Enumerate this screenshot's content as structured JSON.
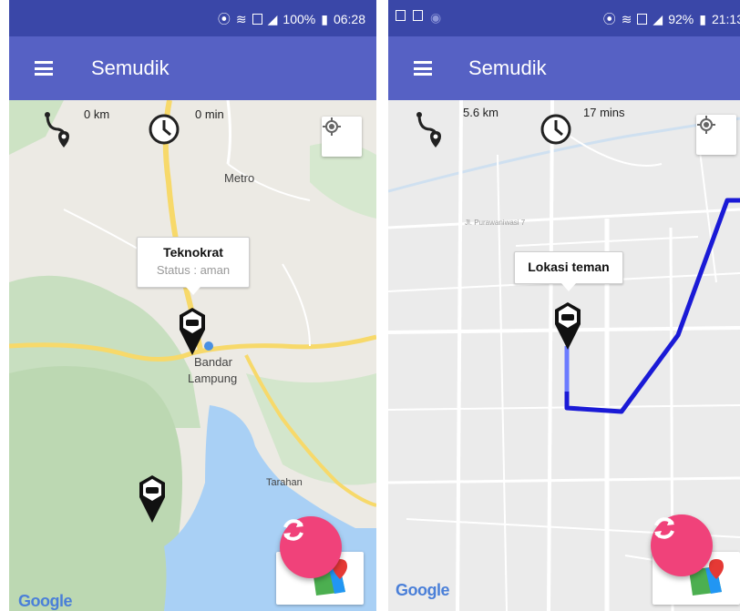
{
  "colors": {
    "appbar": "#5661c4",
    "statusbar": "#3a47a8",
    "fab": "#f0427a",
    "route": "#1a1ad6"
  },
  "screen1": {
    "status": {
      "battery": "100%",
      "time": "06:28"
    },
    "app_title": "Semudik",
    "distance": "0 km",
    "duration": "0 min",
    "map_labels": {
      "metro": "Metro",
      "city_line1": "Bandar",
      "city_line2": "Lampung",
      "tarahan": "Tarahan"
    },
    "info_window": {
      "title": "Teknokrat",
      "status": "Status : aman"
    },
    "google": "Google"
  },
  "screen2": {
    "status": {
      "battery": "92%",
      "time": "21:13"
    },
    "app_title": "Semudik",
    "distance": "5.6 km",
    "duration": "17 mins",
    "info_window": {
      "title": "Lokasi teman"
    },
    "google": "Google"
  },
  "icons": {
    "menu": "hamburger-icon",
    "route": "route-icon",
    "clock": "clock-icon",
    "locate": "my-location-icon",
    "refresh": "refresh-icon",
    "marker": "car-marker-icon"
  }
}
